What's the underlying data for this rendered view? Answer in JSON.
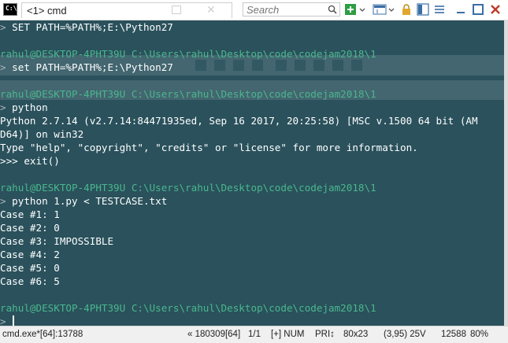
{
  "window": {
    "tab_title": "<1> cmd",
    "search_placeholder": "Search"
  },
  "console": {
    "lines": [
      {
        "kind": "cmd",
        "text": "SET PATH=%PATH%;E:\\Python27"
      },
      {
        "kind": "blank",
        "text": ""
      },
      {
        "kind": "prompt",
        "user": "rahul@DESKTOP-4PHT39U",
        "path": "C:\\Users\\rahul\\Desktop\\code\\codejam2018\\1"
      },
      {
        "kind": "cmd",
        "text": "set PATH=%PATH%;E:\\Python27"
      },
      {
        "kind": "blank",
        "text": ""
      },
      {
        "kind": "prompt",
        "user": "rahul@DESKTOP-4PHT39U",
        "path": "C:\\Users\\rahul\\Desktop\\code\\codejam2018\\1"
      },
      {
        "kind": "cmd",
        "text": "python"
      },
      {
        "kind": "out",
        "text": "Python 2.7.14 (v2.7.14:84471935ed, Sep 16 2017, 20:25:58) [MSC v.1500 64 bit (AM"
      },
      {
        "kind": "out",
        "text": "D64)] on win32"
      },
      {
        "kind": "out",
        "text": "Type \"help\", \"copyright\", \"credits\" or \"license\" for more information."
      },
      {
        "kind": "out",
        "text": ">>> exit()"
      },
      {
        "kind": "blank",
        "text": ""
      },
      {
        "kind": "prompt",
        "user": "rahul@DESKTOP-4PHT39U",
        "path": "C:\\Users\\rahul\\Desktop\\code\\codejam2018\\1"
      },
      {
        "kind": "cmd",
        "text": "python 1.py < TESTCASE.txt"
      },
      {
        "kind": "out",
        "text": "Case #1: 1"
      },
      {
        "kind": "out",
        "text": "Case #2: 0"
      },
      {
        "kind": "out",
        "text": "Case #3: IMPOSSIBLE"
      },
      {
        "kind": "out",
        "text": "Case #4: 2"
      },
      {
        "kind": "out",
        "text": "Case #5: 0"
      },
      {
        "kind": "out",
        "text": "Case #6: 5"
      },
      {
        "kind": "blank",
        "text": ""
      },
      {
        "kind": "prompt",
        "user": "rahul@DESKTOP-4PHT39U",
        "path": "C:\\Users\\rahul\\Desktop\\code\\codejam2018\\1"
      },
      {
        "kind": "input",
        "text": ""
      }
    ],
    "prompt_symbol": ">"
  },
  "statusbar": {
    "process": "cmd.exe*[64]:13788",
    "position": "« 180309[64]",
    "pane": "1/1",
    "indicators": "[+] NUM",
    "priority": "PRI↕",
    "size": "80x23",
    "cursor": "(3,95) 25V",
    "buffer": "12588",
    "zoom": "80%"
  },
  "colors": {
    "background": "#2a515c",
    "prompt_user": "#4ab78d",
    "text": "#ffffff",
    "prompt_symbol": "#aab6ba"
  }
}
